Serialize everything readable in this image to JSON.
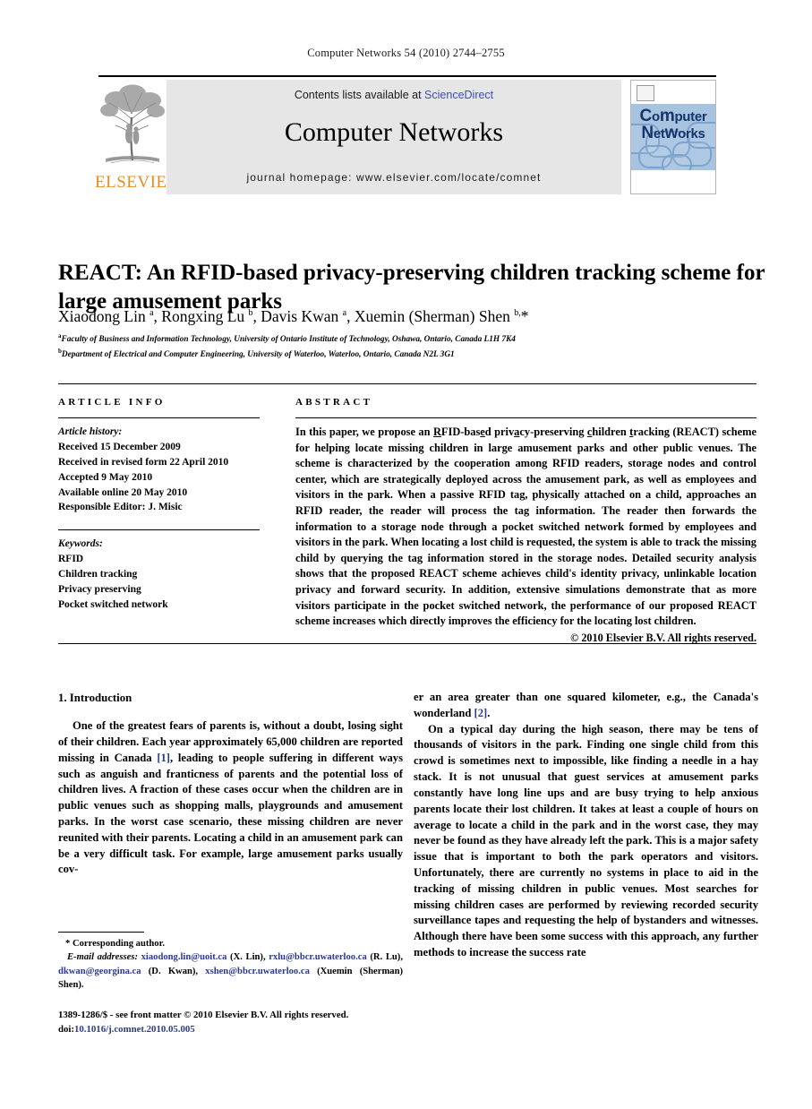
{
  "running_head": "Computer Networks 54 (2010) 2744–2755",
  "masthead": {
    "contents_prefix": "Contents lists available at",
    "sciencedirect": "ScienceDirect",
    "journal_title": "Computer Networks",
    "homepage": "journal homepage: www.elsevier.com/locate/comnet",
    "publisher_wordmark": "ELSEVIER",
    "cover": {
      "line1": "Computer",
      "line2": "Networks"
    },
    "accent_link_color": "#3b4cc0",
    "publisher_color": "#ea8b1f",
    "band_color": "#e6e6e6",
    "cover_band_color": "#a8c3e0"
  },
  "article": {
    "title": "REACT: An RFID-based privacy-preserving children tracking scheme for large amusement parks",
    "authors_html": "Xiaodong Lin <sup>a</sup>, Rongxing Lu <sup>b</sup>, Davis Kwan <sup>a</sup>, Xuemin (Sherman) Shen <sup>b,</sup>*",
    "affiliations": [
      "Faculty of Business and Information Technology, University of Ontario Institute of Technology, Oshawa, Ontario, Canada L1H 7K4",
      "Department of Electrical and Computer Engineering, University of Waterloo, Waterloo, Ontario, Canada N2L 3G1"
    ],
    "affiliation_marks": [
      "a",
      "b"
    ]
  },
  "info": {
    "article_info_heading": "ARTICLE INFO",
    "abstract_heading": "ABSTRACT",
    "history_label": "Article history:",
    "history": [
      "Received 15 December 2009",
      "Received in revised form 22 April 2010",
      "Accepted 9 May 2010",
      "Available online 20 May 2010",
      "Responsible Editor: J. Misic"
    ],
    "keywords_label": "Keywords:",
    "keywords": [
      "RFID",
      "Children tracking",
      "Privacy preserving",
      "Pocket switched network"
    ]
  },
  "abstract": {
    "text_html": "In this paper, we propose an <u>R</u>FID-bas<u>e</u>d priv<u>a</u>cy-preserving <u>c</u>hildren <u>t</u>racking (REACT) scheme for helping locate missing children in large amusement parks and other public venues. The scheme is characterized by the cooperation among RFID readers, storage nodes and control center, which are strategically deployed across the amusement park, as well as employees and visitors in the park. When a passive RFID tag, physically attached on a child, approaches an RFID reader, the reader will process the tag information. The reader then forwards the information to a storage node through a pocket switched network formed by employees and visitors in the park. When locating a lost child is requested, the system is able to track the missing child by querying the tag information stored in the storage nodes. Detailed security analysis shows that the proposed REACT scheme achieves child's identity privacy, unlinkable location privacy and forward security. In addition, extensive simulations demonstrate that as more visitors participate in the pocket switched network, the performance of our proposed REACT scheme increases which directly improves the efficiency for the locating lost children.",
    "copyright": "© 2010 Elsevier B.V. All rights reserved."
  },
  "body": {
    "section_number_title": "1. Introduction",
    "left_paragraph_html": "One of the greatest fears of parents is, without a doubt, losing sight of their children. Each year approximately 65,000 children are reported missing in Canada <span class=\"ref\">[1]</span>, leading to people suffering in different ways such as anguish and franticness of parents and the potential loss of children lives. A fraction of these cases occur when the children are in public venues such as shopping malls, playgrounds and amusement parks. In the worst case scenario, these missing children are never reunited with their parents. Locating a child in an amusement park can be a very difficult task. For example, large amusement parks usually cov-",
    "right_paragraph_1_html": "er an area greater than one squared kilometer, e.g., the Canada's wonderland <span class=\"ref\">[2]</span>.",
    "right_paragraph_2_html": "On a typical day during the high season, there may be tens of thousands of visitors in the park. Finding one single child from this crowd is sometimes next to impossible, like finding a needle in a hay stack. It is not unusual that guest services at amusement parks constantly have long line ups and are busy trying to help anxious parents locate their lost children. It takes at least a couple of hours on average to locate a child in the park and in the worst case, they may never be found as they have already left the park. This is a major safety issue that is important to both the park operators and visitors. Unfortunately, there are currently no systems in place to aid in the tracking of missing children in public venues. Most searches for missing children cases are performed by reviewing recorded security surveillance tapes and requesting the help of bystanders and witnesses. Although there have been some success with this approach, any further methods to increase the success rate"
  },
  "footnotes": {
    "corresponding_author": "* Corresponding author.",
    "email_label": "E-mail addresses:",
    "emails_html": "<span class=\"mail\">xiaodong.lin@uoit.ca</span> (X. Lin), <span class=\"mail\">rxlu@bbcr.uwaterloo.ca</span> (R. Lu), <span class=\"mail\">dkwan@georgina.ca</span> (D. Kwan), <span class=\"mail\">xshen@bbcr.uwaterloo.ca</span> (Xuemin (Sherman) Shen).",
    "issn_line": "1389-1286/$ - see front matter © 2010 Elsevier B.V. All rights reserved.",
    "doi_label": "doi:",
    "doi_value": "10.1016/j.comnet.2010.05.005",
    "link_color": "#2a3b8f"
  }
}
